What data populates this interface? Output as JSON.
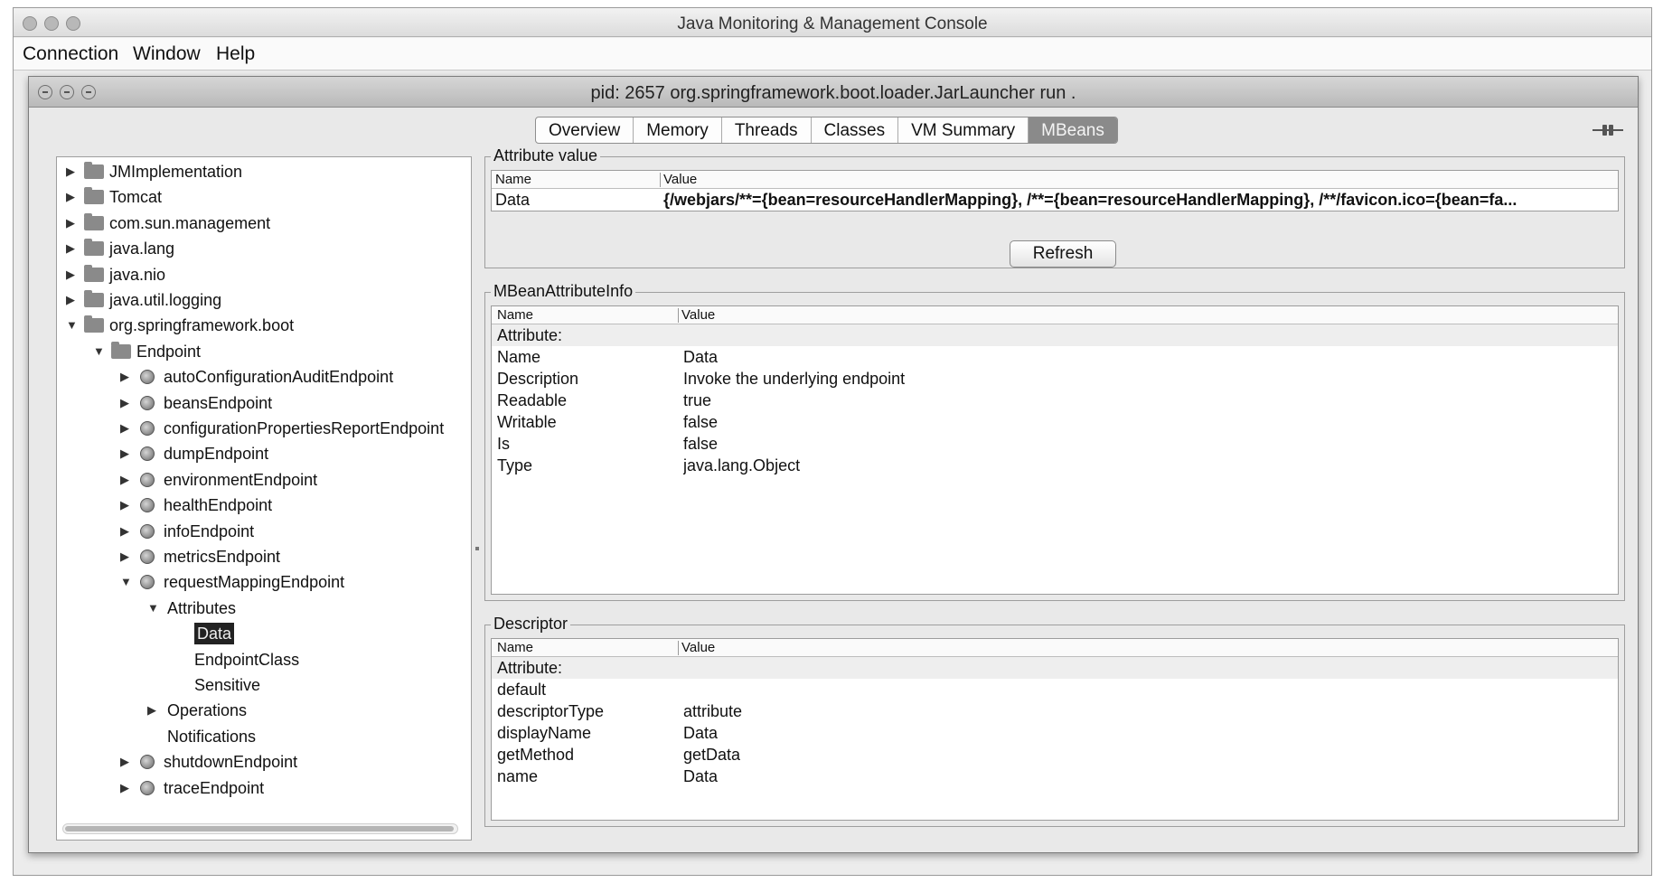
{
  "outer_window": {
    "title": "Java Monitoring & Management Console",
    "menu": [
      "Connection",
      "Window",
      "Help"
    ]
  },
  "inner_window": {
    "title": "pid: 2657 org.springframework.boot.loader.JarLauncher run ."
  },
  "tabs": [
    {
      "label": "Overview",
      "active": false
    },
    {
      "label": "Memory",
      "active": false
    },
    {
      "label": "Threads",
      "active": false
    },
    {
      "label": "Classes",
      "active": false
    },
    {
      "label": "VM Summary",
      "active": false
    },
    {
      "label": "MBeans",
      "active": true
    }
  ],
  "tree": [
    {
      "label": "JMImplementation",
      "icon": "folder",
      "arrow": "▶",
      "selected": false
    },
    {
      "label": "Tomcat",
      "icon": "folder",
      "arrow": "▶",
      "selected": false
    },
    {
      "label": "com.sun.management",
      "icon": "folder",
      "arrow": "▶",
      "selected": false
    },
    {
      "label": "java.lang",
      "icon": "folder",
      "arrow": "▶",
      "selected": false
    },
    {
      "label": "java.nio",
      "icon": "folder",
      "arrow": "▶",
      "selected": false
    },
    {
      "label": "java.util.logging",
      "icon": "folder",
      "arrow": "▶",
      "selected": false
    },
    {
      "label": "org.springframework.boot",
      "icon": "folder",
      "arrow": "▼",
      "selected": false
    },
    {
      "label": "Endpoint",
      "icon": "folder",
      "arrow": "▼",
      "selected": false
    },
    {
      "label": "autoConfigurationAuditEndpoint",
      "icon": "bean",
      "arrow": "▶",
      "selected": false
    },
    {
      "label": "beansEndpoint",
      "icon": "bean",
      "arrow": "▶",
      "selected": false
    },
    {
      "label": "configurationPropertiesReportEndpoint",
      "icon": "bean",
      "arrow": "▶",
      "selected": false
    },
    {
      "label": "dumpEndpoint",
      "icon": "bean",
      "arrow": "▶",
      "selected": false
    },
    {
      "label": "environmentEndpoint",
      "icon": "bean",
      "arrow": "▶",
      "selected": false
    },
    {
      "label": "healthEndpoint",
      "icon": "bean",
      "arrow": "▶",
      "selected": false
    },
    {
      "label": "infoEndpoint",
      "icon": "bean",
      "arrow": "▶",
      "selected": false
    },
    {
      "label": "metricsEndpoint",
      "icon": "bean",
      "arrow": "▶",
      "selected": false
    },
    {
      "label": "requestMappingEndpoint",
      "icon": "bean",
      "arrow": "▼",
      "selected": false
    },
    {
      "label": "Attributes",
      "icon": "",
      "arrow": "▼",
      "selected": false
    },
    {
      "label": "Data",
      "icon": "",
      "arrow": "",
      "selected": true
    },
    {
      "label": "EndpointClass",
      "icon": "",
      "arrow": "",
      "selected": false
    },
    {
      "label": "Sensitive",
      "icon": "",
      "arrow": "",
      "selected": false
    },
    {
      "label": "Operations",
      "icon": "",
      "arrow": "▶",
      "selected": false
    },
    {
      "label": "Notifications",
      "icon": "",
      "arrow": "",
      "selected": false
    },
    {
      "label": "shutdownEndpoint",
      "icon": "bean",
      "arrow": "▶",
      "selected": false
    },
    {
      "label": "traceEndpoint",
      "icon": "bean",
      "arrow": "▶",
      "selected": false
    }
  ],
  "attribute_value": {
    "title": "Attribute value",
    "col_name": "Name",
    "col_value": "Value",
    "row_name": "Data",
    "row_value": "{/webjars/**={bean=resourceHandlerMapping}, /**={bean=resourceHandlerMapping}, /**/favicon.ico={bean=fa...",
    "refresh_label": "Refresh"
  },
  "mbean_attribute_info": {
    "title": "MBeanAttributeInfo",
    "col_name": "Name",
    "col_value": "Value",
    "rows": [
      {
        "name": "Attribute:",
        "value": "",
        "shaded": true
      },
      {
        "name": "Name",
        "value": "Data",
        "shaded": false
      },
      {
        "name": "Description",
        "value": "Invoke the underlying endpoint",
        "shaded": false
      },
      {
        "name": "Readable",
        "value": "true",
        "shaded": false
      },
      {
        "name": "Writable",
        "value": "false",
        "shaded": false
      },
      {
        "name": "Is",
        "value": "false",
        "shaded": false
      },
      {
        "name": "Type",
        "value": "java.lang.Object",
        "shaded": false
      }
    ]
  },
  "descriptor": {
    "title": "Descriptor",
    "col_name": "Name",
    "col_value": "Value",
    "rows": [
      {
        "name": "Attribute:",
        "value": "",
        "shaded": true
      },
      {
        "name": "default",
        "value": "",
        "shaded": false
      },
      {
        "name": "descriptorType",
        "value": "attribute",
        "shaded": false
      },
      {
        "name": "displayName",
        "value": "Data",
        "shaded": false
      },
      {
        "name": "getMethod",
        "value": "getData",
        "shaded": false
      },
      {
        "name": "name",
        "value": "Data",
        "shaded": false
      }
    ]
  }
}
